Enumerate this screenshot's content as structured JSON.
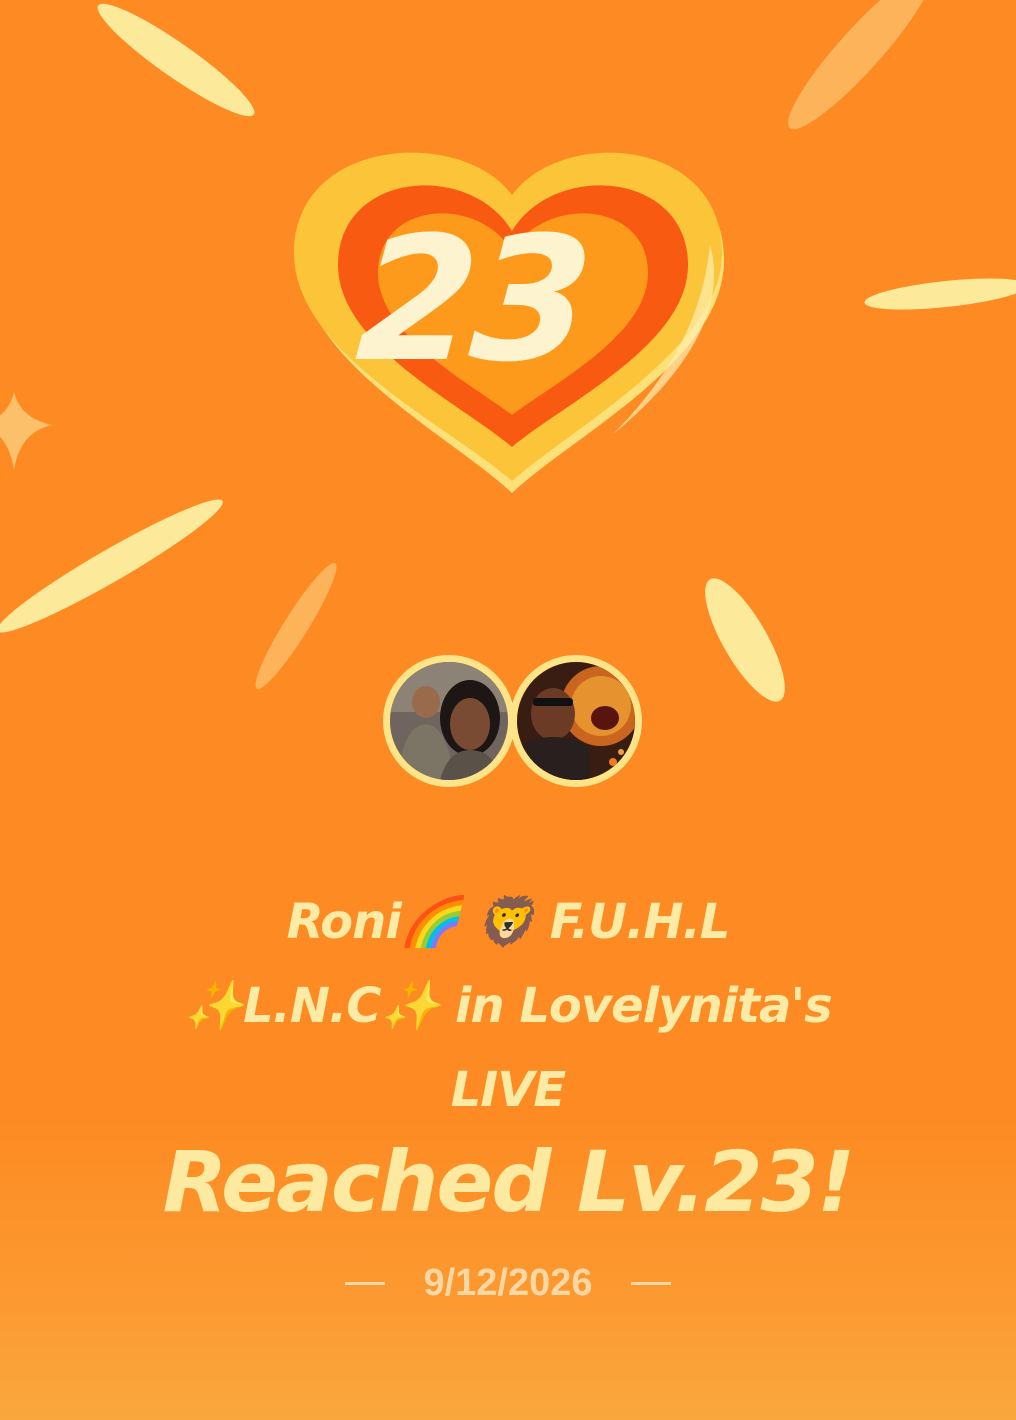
{
  "badge": {
    "level": "23"
  },
  "title": {
    "line1": "Roni🌈 🦁 F.U.H.L",
    "line2": "✨L.N.C✨ in Lovelynita's",
    "line3": "LIVE"
  },
  "headline": "Reached Lv.23!",
  "date": "9/12/2026",
  "colors": {
    "background": "#fd8a22",
    "text": "#fdeba5",
    "ray": "#fde99a",
    "heart_outer": "#fdc83c",
    "heart_inner": "#f85a12"
  }
}
